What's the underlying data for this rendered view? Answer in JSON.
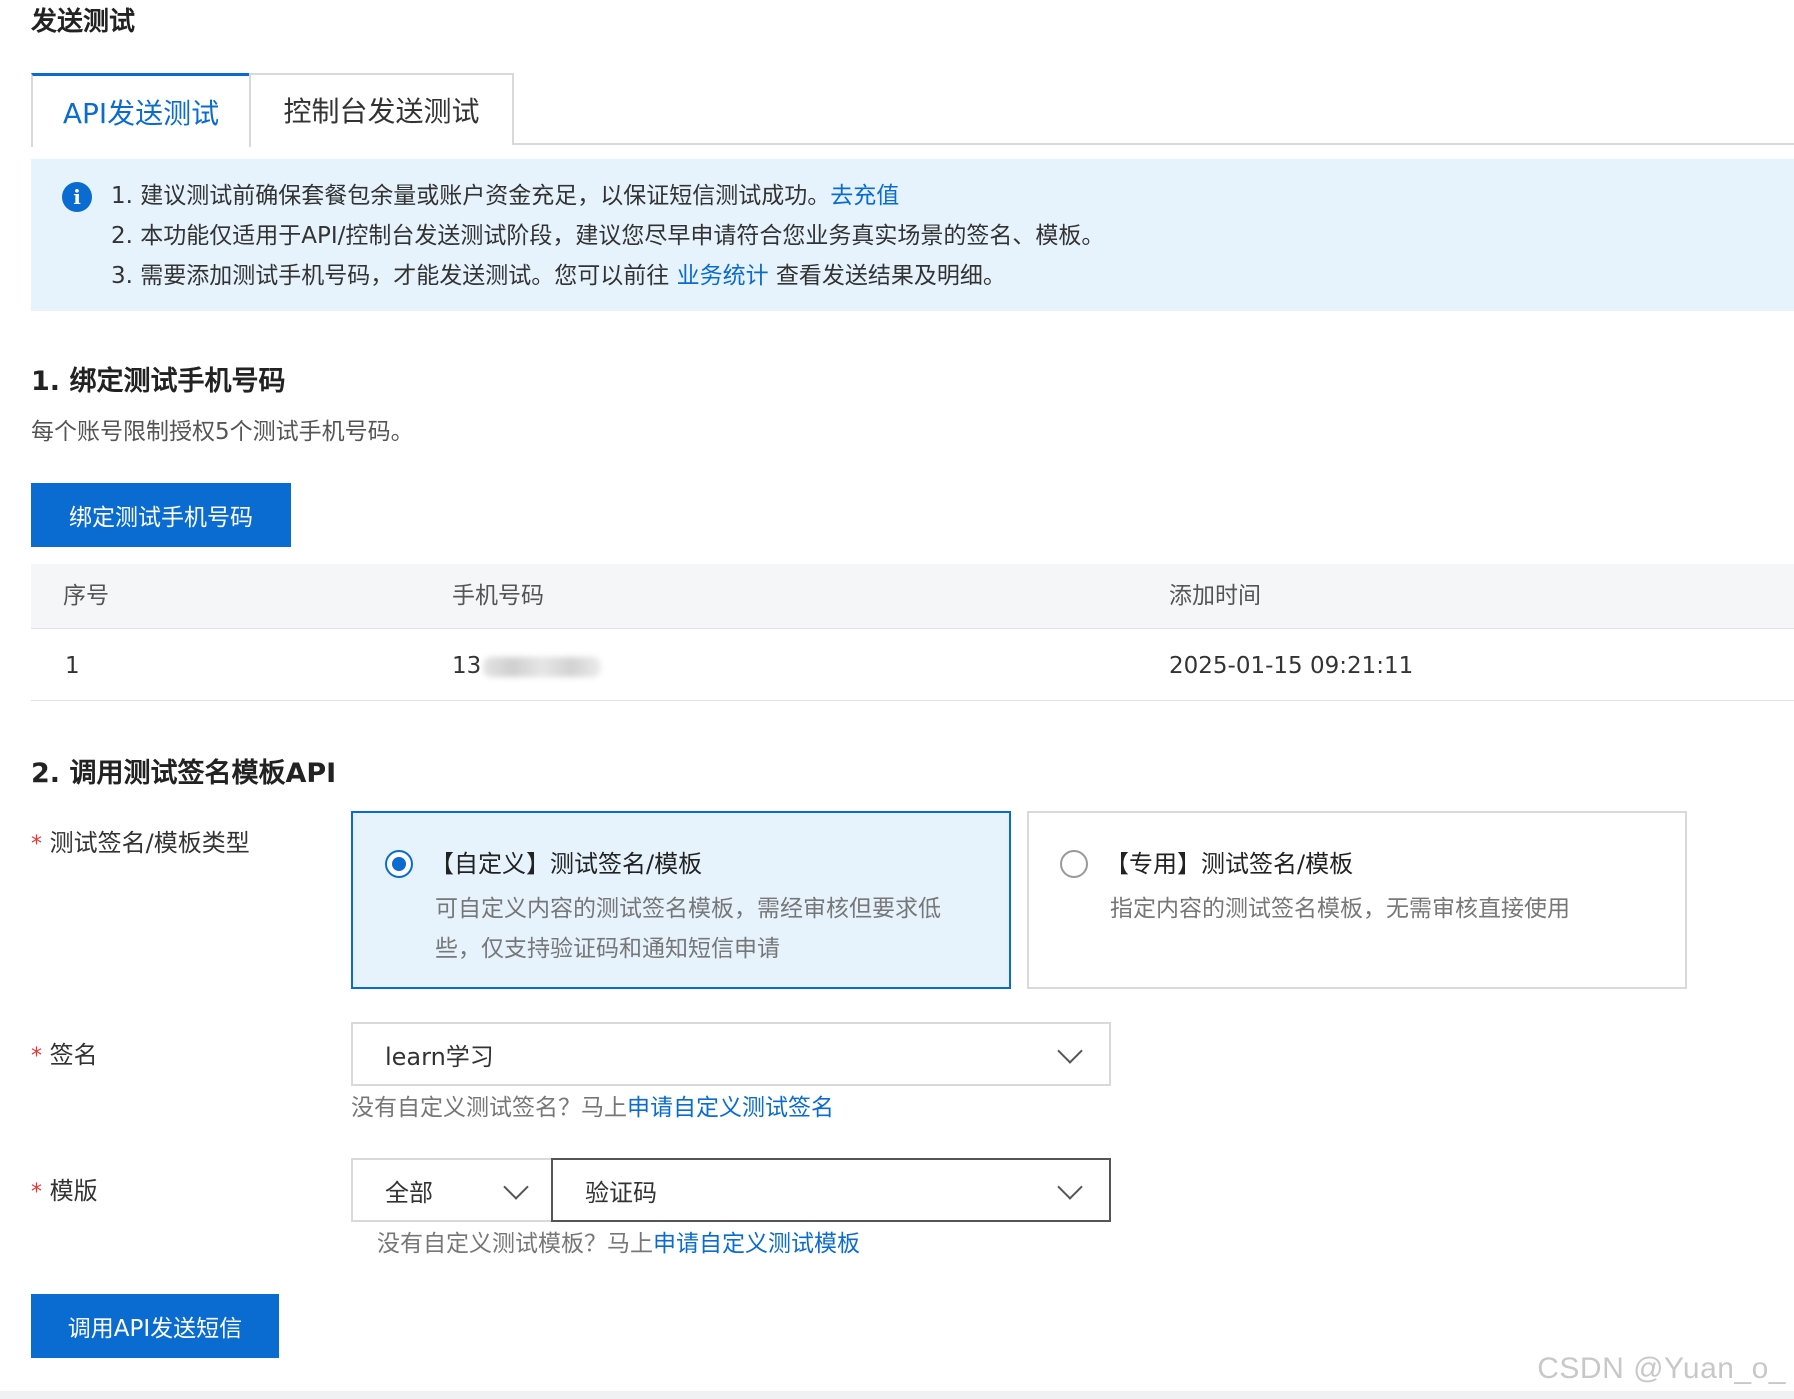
{
  "page": {
    "title": "发送测试"
  },
  "tabs": [
    {
      "label": "API发送测试",
      "active": true
    },
    {
      "label": "控制台发送测试",
      "active": false
    }
  ],
  "notice": {
    "line1": "1. 建议测试前确保套餐包余量或账户资金充足，以保证短信测试成功。",
    "line1_link": "去充值",
    "line2": "2. 本功能仅适用于API/控制台发送测试阶段，建议您尽早申请符合您业务真实场景的签名、模板。",
    "line3_prefix": "3. 需要添加测试手机号码，才能发送测试。您可以前往 ",
    "line3_link": "业务统计",
    "line3_suffix": " 查看发送结果及明细。"
  },
  "section1": {
    "title": "1. 绑定测试手机号码",
    "desc": "每个账号限制授权5个测试手机号码。",
    "bind_button": "绑定测试手机号码"
  },
  "table": {
    "headers": [
      "序号",
      "手机号码",
      "添加时间"
    ],
    "rows": [
      {
        "index": "1",
        "phone_visible": "13",
        "added": "2025-01-15 09:21:11"
      }
    ]
  },
  "section2": {
    "title": "2. 调用测试签名模板API",
    "required_mark": "*",
    "type_label": "测试签名/模板类型",
    "options": [
      {
        "title": "【自定义】测试签名/模板",
        "desc_line1": "可自定义内容的测试签名模板，需经审核但要求低",
        "desc_line2": "些，仅支持验证码和通知短信申请",
        "selected": true
      },
      {
        "title": "【专用】测试签名/模板",
        "desc_line1": "指定内容的测试签名模板，无需审核直接使用",
        "selected": false
      }
    ],
    "signature_label": "签名",
    "signature_value": "learn学习",
    "signature_hint": "没有自定义测试签名？马上",
    "signature_hint_link": "申请自定义测试签名",
    "template_label": "模版",
    "template_filter_value": "全部",
    "template_value": "验证码",
    "template_hint": "没有自定义测试模板？马上",
    "template_hint_link": "申请自定义测试模板",
    "send_button": "调用API发送短信"
  },
  "watermark": "CSDN @Yuan_o_",
  "colors": {
    "primary": "#0a6cd0",
    "notice_bg": "#e6f3fc",
    "required": "#e33333",
    "table_header_bg": "#f5f6f8"
  },
  "icons": {
    "info": "info-icon",
    "dropdown": "chevron-down-icon"
  }
}
